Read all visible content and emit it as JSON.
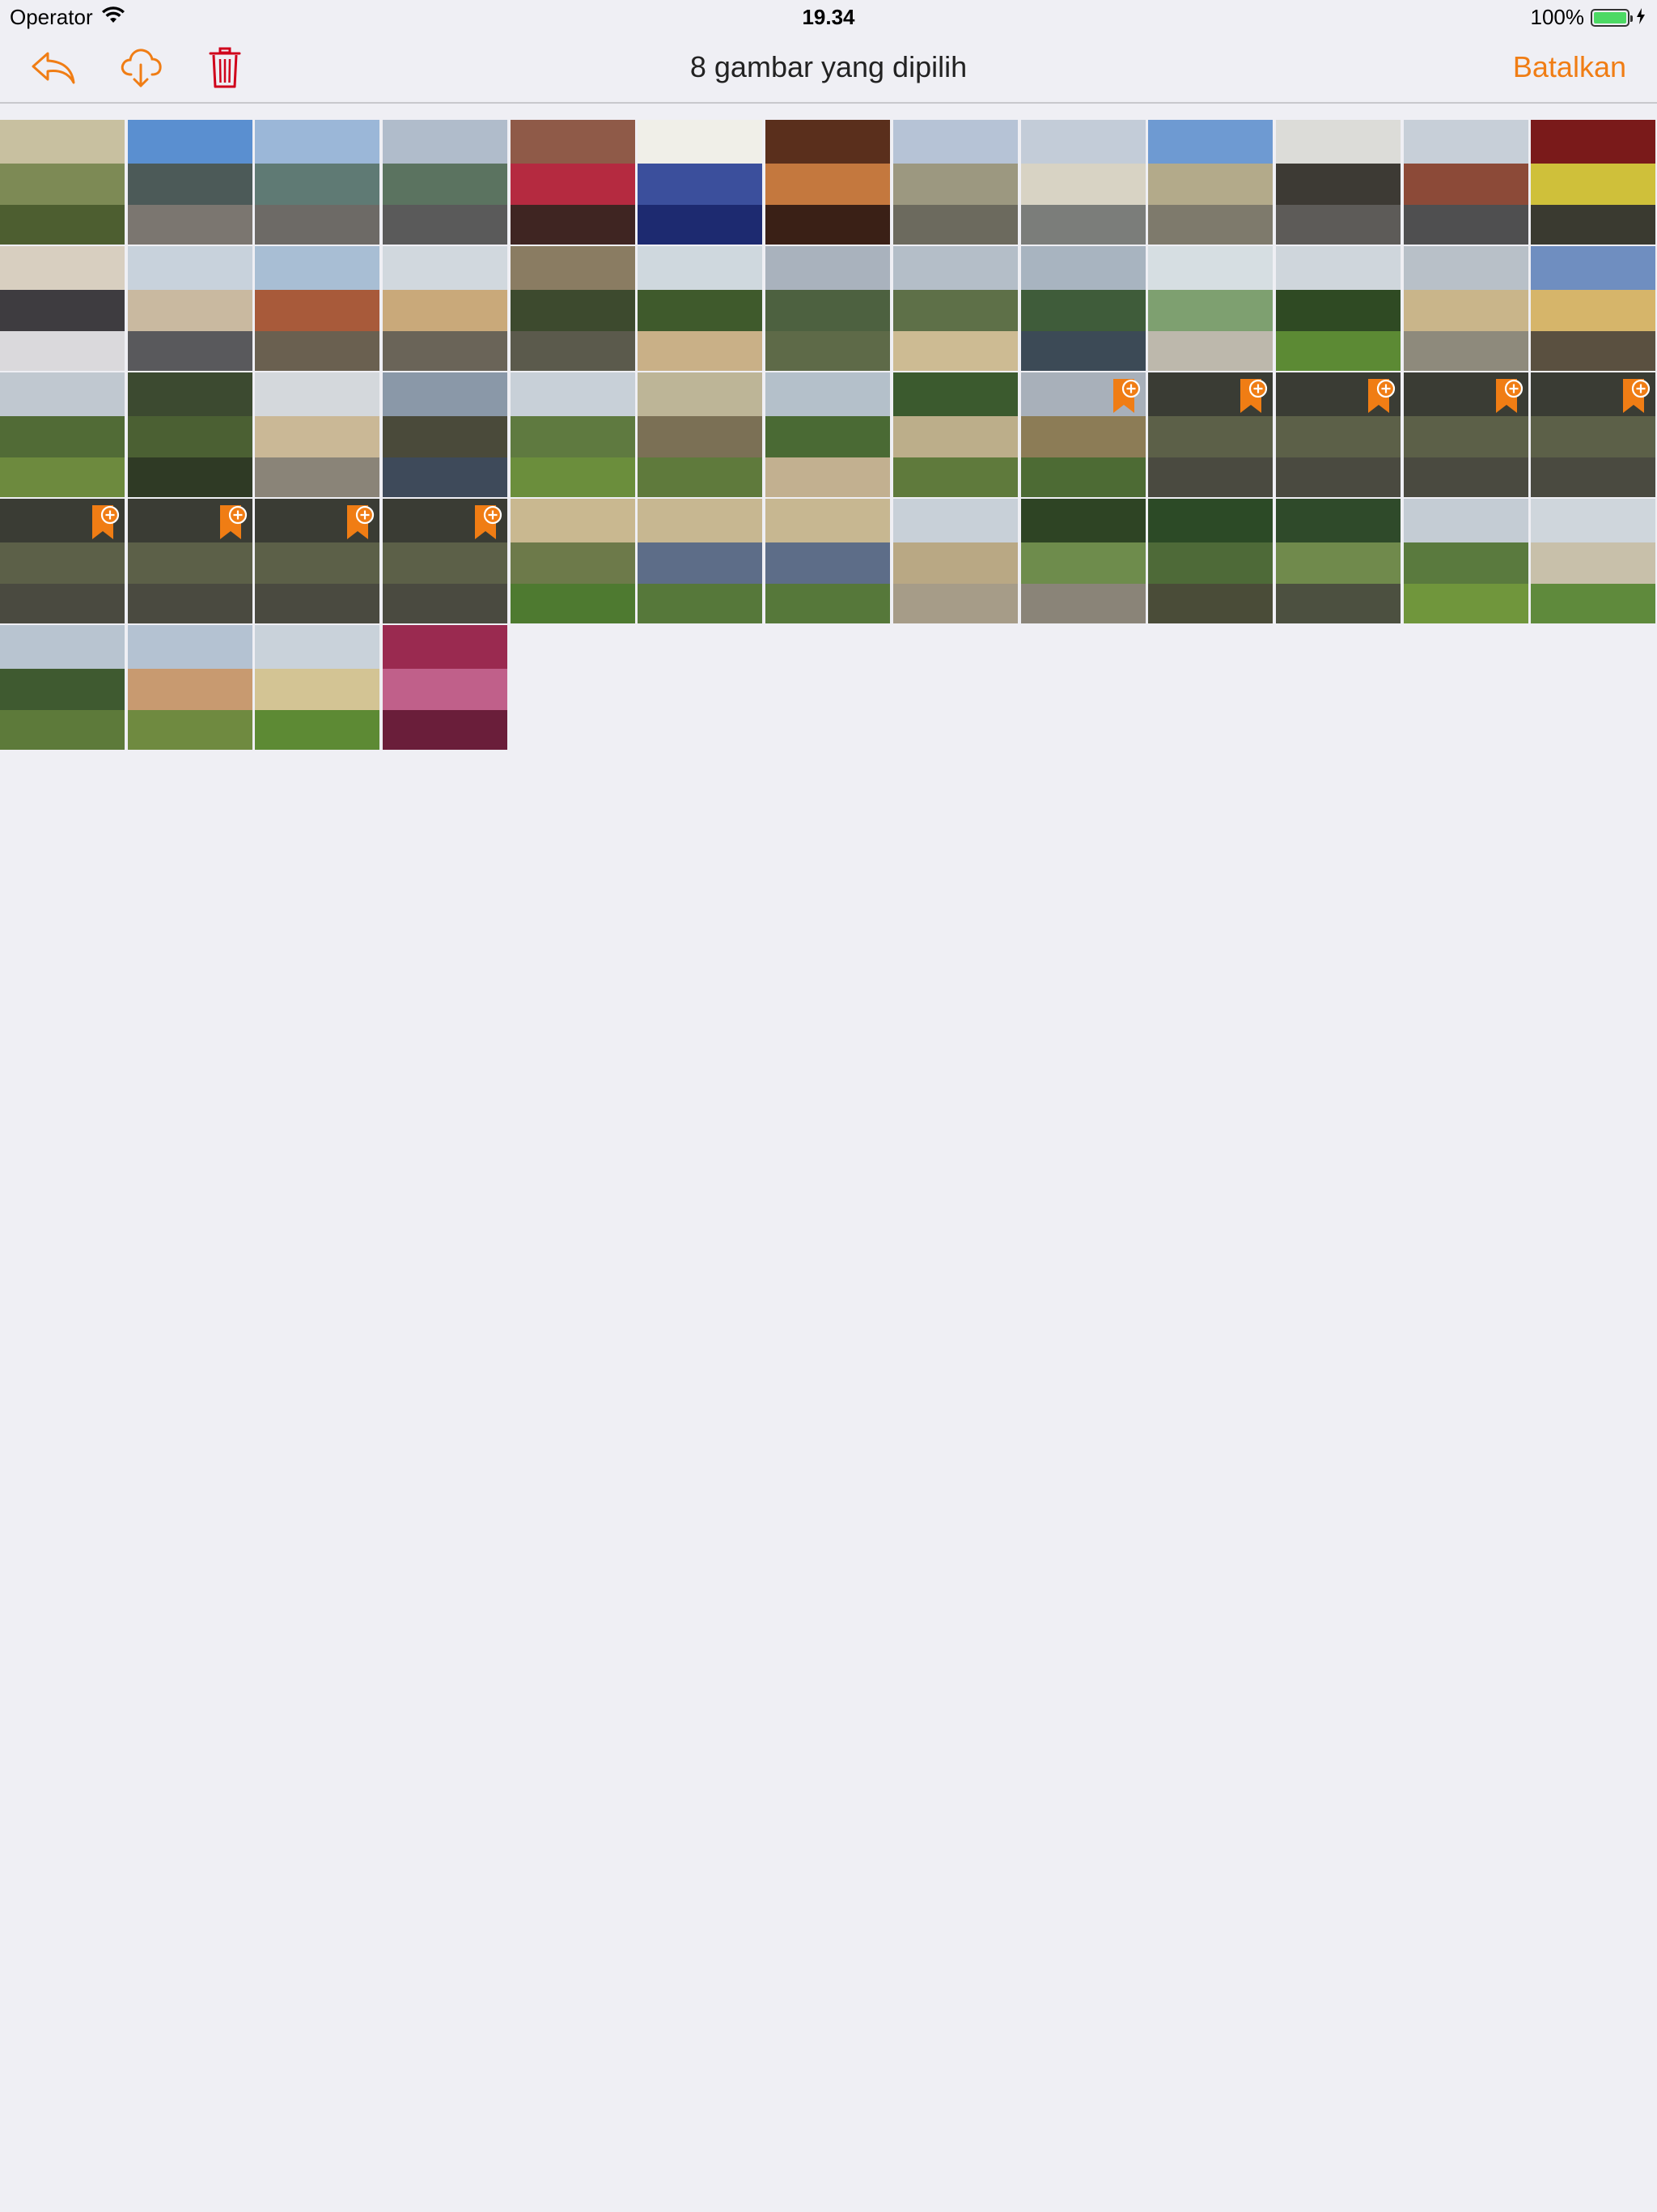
{
  "status_bar": {
    "carrier": "Operator",
    "time": "19.34",
    "battery_percent": "100%",
    "battery_level": 1.0
  },
  "nav": {
    "title": "8 gambar yang dipilih",
    "cancel_label": "Batalkan",
    "icons": [
      "reply-icon",
      "cloud-download-icon",
      "trash-icon"
    ]
  },
  "colors": {
    "accent": "#f07d14",
    "delete": "#d0021b",
    "background": "#efeff4"
  },
  "photos": [
    {
      "palette": [
        "#c8c0a0",
        "#7d8a55",
        "#4d5e30"
      ],
      "selected": false
    },
    {
      "palette": [
        "#5a8fd0",
        "#4c5a58",
        "#7b7670"
      ],
      "selected": false
    },
    {
      "palette": [
        "#9bb7d8",
        "#5f7a74",
        "#6d6a66"
      ],
      "selected": false
    },
    {
      "palette": [
        "#b0bccb",
        "#5b7360",
        "#5a5a5a"
      ],
      "selected": false
    },
    {
      "palette": [
        "#8f5a48",
        "#b52a40",
        "#3f2522"
      ],
      "selected": false
    },
    {
      "palette": [
        "#f0efe8",
        "#3b4f9c",
        "#1d2a70"
      ],
      "selected": false
    },
    {
      "palette": [
        "#5a2f1c",
        "#c4783e",
        "#3a2016"
      ],
      "selected": false
    },
    {
      "palette": [
        "#b6c3d6",
        "#9c9880",
        "#6c6a5e"
      ],
      "selected": false
    },
    {
      "palette": [
        "#c3ccd8",
        "#d8d3c4",
        "#7b7d7a"
      ],
      "selected": false
    },
    {
      "palette": [
        "#6e9ad2",
        "#b3aa8a",
        "#7e7a6c"
      ],
      "selected": false
    },
    {
      "palette": [
        "#dcdcd8",
        "#3d3a34",
        "#5d5b58"
      ],
      "selected": false
    },
    {
      "palette": [
        "#c7cfd8",
        "#8c4a38",
        "#4f4f50"
      ],
      "selected": false
    },
    {
      "palette": [
        "#7a1a1a",
        "#cfc03a",
        "#3a3a30"
      ],
      "selected": false
    },
    {
      "palette": [
        "#d8cfc0",
        "#3e3c40",
        "#dad9dc"
      ],
      "selected": false
    },
    {
      "palette": [
        "#c8d2dc",
        "#c9b9a0",
        "#59595c"
      ],
      "selected": false
    },
    {
      "palette": [
        "#a8bed4",
        "#a85a3a",
        "#6a6050"
      ],
      "selected": false
    },
    {
      "palette": [
        "#d1d8de",
        "#c9a97a",
        "#6a6458"
      ],
      "selected": false
    },
    {
      "palette": [
        "#8a7c62",
        "#3d4a2e",
        "#5b5a4c"
      ],
      "selected": false
    },
    {
      "palette": [
        "#cfd8de",
        "#3f5a2c",
        "#c9b087"
      ],
      "selected": false
    },
    {
      "palette": [
        "#a9b2bd",
        "#4d6140",
        "#5e6a48"
      ],
      "selected": false
    },
    {
      "palette": [
        "#b4bec8",
        "#5e7048",
        "#cdbb93"
      ],
      "selected": false
    },
    {
      "palette": [
        "#a8b4c0",
        "#3f5c3a",
        "#3c4a56"
      ],
      "selected": false
    },
    {
      "palette": [
        "#d6dee2",
        "#7ea070",
        "#bdb8ac"
      ],
      "selected": false
    },
    {
      "palette": [
        "#cfd6dc",
        "#2f4a23",
        "#5c8a34"
      ],
      "selected": false
    },
    {
      "palette": [
        "#b8c0c8",
        "#c9b58a",
        "#8e8a7c"
      ],
      "selected": false
    },
    {
      "palette": [
        "#6f8ec0",
        "#d6b56a",
        "#5a5040"
      ],
      "selected": false
    },
    {
      "palette": [
        "#c0c8d0",
        "#516b36",
        "#6d8a3e"
      ],
      "selected": false
    },
    {
      "palette": [
        "#3c4a30",
        "#4b6033",
        "#2f3a25"
      ],
      "selected": false
    },
    {
      "palette": [
        "#d4d8dc",
        "#cab896",
        "#8a8478"
      ],
      "selected": false
    },
    {
      "palette": [
        "#8a98a8",
        "#4a4a3a",
        "#3e4a5a"
      ],
      "selected": false
    },
    {
      "palette": [
        "#c8d0d8",
        "#5f7a40",
        "#6b8e3c"
      ],
      "selected": false
    },
    {
      "palette": [
        "#bdb597",
        "#7b7055",
        "#5f7a3c"
      ],
      "selected": false
    },
    {
      "palette": [
        "#b4c0ca",
        "#4a6a34",
        "#c2b090"
      ],
      "selected": false
    },
    {
      "palette": [
        "#3b5a2e",
        "#bcae8a",
        "#5f7a3c"
      ],
      "selected": false
    },
    {
      "palette": [
        "#a8b0ba",
        "#8c7c56",
        "#4d6b34"
      ],
      "selected": true
    },
    {
      "palette": [
        "#3a3c34",
        "#5c6048",
        "#4a4a40"
      ],
      "selected": true
    },
    {
      "palette": [
        "#3a3c34",
        "#5c6048",
        "#4a4a40"
      ],
      "selected": true
    },
    {
      "palette": [
        "#3a3c34",
        "#5c6048",
        "#4a4a40"
      ],
      "selected": true
    },
    {
      "palette": [
        "#3a3c34",
        "#5c6048",
        "#4a4a40"
      ],
      "selected": true
    },
    {
      "palette": [
        "#3a3c34",
        "#5c6048",
        "#4a4a40"
      ],
      "selected": true
    },
    {
      "palette": [
        "#3a3c34",
        "#5c6048",
        "#4a4a40"
      ],
      "selected": true
    },
    {
      "palette": [
        "#3a3c34",
        "#5c6048",
        "#4a4a40"
      ],
      "selected": true
    },
    {
      "palette": [
        "#3a3c34",
        "#5c6048",
        "#4a4a40"
      ],
      "selected": true
    },
    {
      "palette": [
        "#c9b890",
        "#6d7a4a",
        "#4e7a30"
      ],
      "selected": false
    },
    {
      "palette": [
        "#c7b791",
        "#5d6d88",
        "#56783a"
      ],
      "selected": false
    },
    {
      "palette": [
        "#c7b791",
        "#5d6d88",
        "#56783a"
      ],
      "selected": false
    },
    {
      "palette": [
        "#c8d0d8",
        "#b9a884",
        "#a69c88"
      ],
      "selected": false
    },
    {
      "palette": [
        "#2e4424",
        "#6e8c4c",
        "#8a8478"
      ],
      "selected": false
    },
    {
      "palette": [
        "#2c4a26",
        "#4e6a38",
        "#4a4c38"
      ],
      "selected": false
    },
    {
      "palette": [
        "#2f4a2a",
        "#708a4c",
        "#4c5040"
      ],
      "selected": false
    },
    {
      "palette": [
        "#c4ccd4",
        "#5a7a3e",
        "#70963c"
      ],
      "selected": false
    },
    {
      "palette": [
        "#cfd6dc",
        "#c8c0aa",
        "#5f8a3c"
      ],
      "selected": false
    },
    {
      "palette": [
        "#b8c4d0",
        "#3f5a30",
        "#5d7a3a"
      ],
      "selected": false
    },
    {
      "palette": [
        "#b4c2d2",
        "#c89a70",
        "#6f8a40"
      ],
      "selected": false
    },
    {
      "palette": [
        "#c9d2da",
        "#d3c494",
        "#5d8a34"
      ],
      "selected": false
    },
    {
      "palette": [
        "#9a2a50",
        "#c0608a",
        "#6a1e3a"
      ],
      "selected": false
    }
  ]
}
